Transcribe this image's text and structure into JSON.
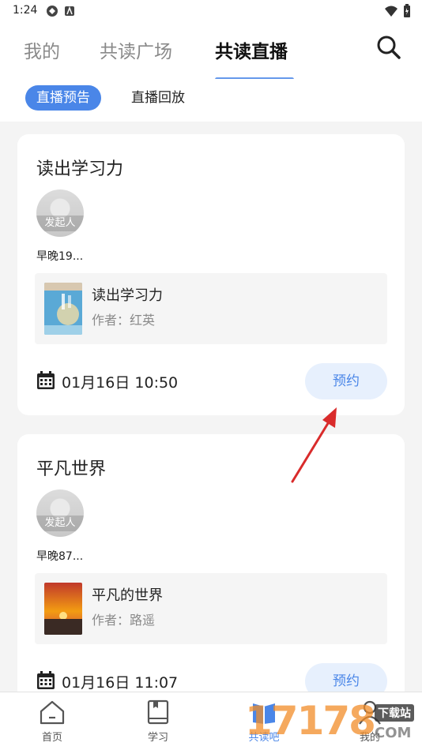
{
  "status": {
    "time": "1:24"
  },
  "topnav": {
    "tabs": [
      {
        "label": "我的"
      },
      {
        "label": "共读广场"
      },
      {
        "label": "共读直播"
      }
    ]
  },
  "subnav": {
    "tabs": [
      {
        "label": "直播预告"
      },
      {
        "label": "直播回放"
      }
    ]
  },
  "cards": [
    {
      "title": "读出学习力",
      "avatar_label": "发起人",
      "host": "早晚19...",
      "book_title": "读出学习力",
      "book_author": "作者：红英",
      "datetime": "01月16日 10:50",
      "button": "预约"
    },
    {
      "title": "平凡世界",
      "avatar_label": "发起人",
      "host": "早晚87...",
      "book_title": "平凡的世界",
      "book_author": "作者：路遥",
      "datetime": "01月16日 11:07",
      "button": "预约"
    }
  ],
  "bottomnav": {
    "items": [
      {
        "label": "首页"
      },
      {
        "label": "学习"
      },
      {
        "label": "共读吧"
      },
      {
        "label": "我的"
      }
    ]
  },
  "watermark": {
    "brand": "17178",
    "tag": "下载站",
    "domain": "COM"
  },
  "colors": {
    "accent": "#4a86e8",
    "annotation_arrow": "#d92b2b"
  }
}
